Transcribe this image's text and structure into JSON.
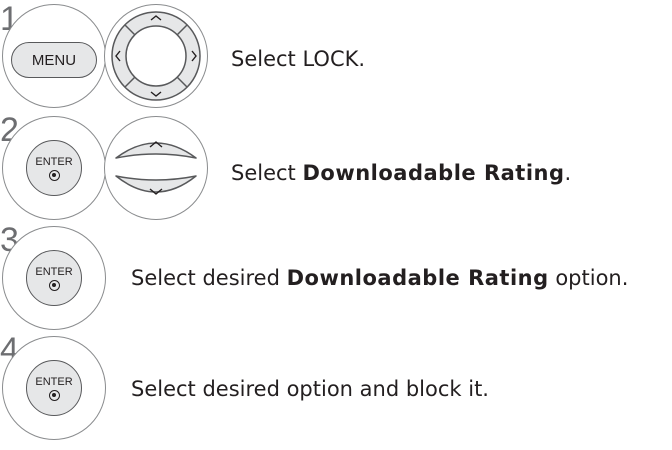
{
  "steps": [
    {
      "number": "1",
      "button_label": "MENU",
      "text": {
        "prefix": "Select LOCK.",
        "bold": "",
        "suffix": ""
      }
    },
    {
      "number": "2",
      "button_label": "ENTER",
      "text": {
        "prefix": "Select ",
        "bold": "Downloadable Rating",
        "suffix": "."
      }
    },
    {
      "number": "3",
      "button_label": "ENTER",
      "text": {
        "prefix": "Select desired ",
        "bold": "Downloadable Rating",
        "suffix": " option."
      }
    },
    {
      "number": "4",
      "button_label": "ENTER",
      "text": {
        "prefix": "Select desired option and block it.",
        "bold": "",
        "suffix": ""
      }
    }
  ],
  "icons": {
    "step1_pad": "four-way-arrow-pad-icon",
    "step2_pad": "up-down-arrow-pad-icon",
    "enter_dot": "enter-dot-icon"
  },
  "colors": {
    "button_fill": "#e6e7e8",
    "outline": "#58595b",
    "step_number": "#6d6e71",
    "text": "#231f20"
  }
}
